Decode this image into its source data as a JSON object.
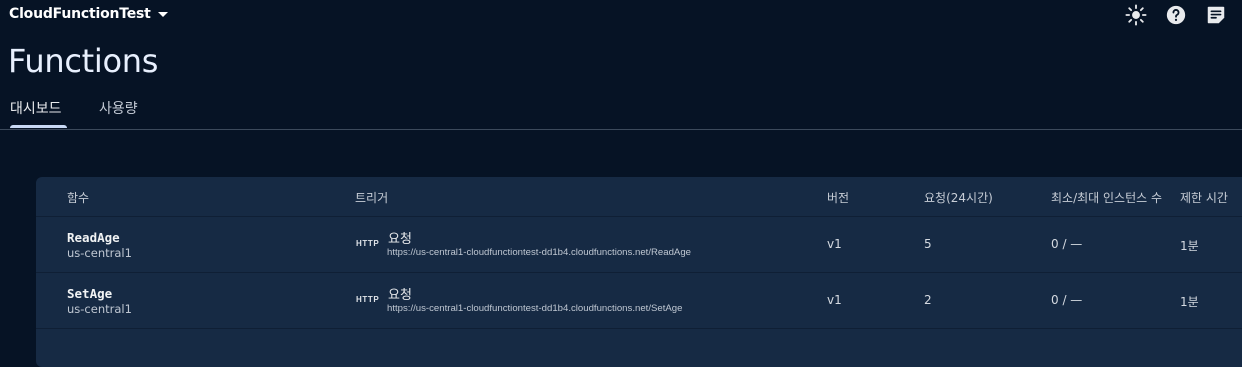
{
  "header": {
    "project": "CloudFunctionTest",
    "icons": [
      "brightness-icon",
      "help-icon",
      "feedback-icon"
    ]
  },
  "page": {
    "title": "Functions"
  },
  "tabs": [
    {
      "label": "대시보드",
      "active": true
    },
    {
      "label": "사용량",
      "active": false
    }
  ],
  "table": {
    "headers": {
      "function": "함수",
      "trigger": "트리거",
      "version": "버전",
      "requests": "요청(24시간)",
      "instances": "최소/최대 인스턴스 수",
      "timeout": "제한 시간"
    },
    "rows": [
      {
        "name": "ReadAge",
        "region": "us-central1",
        "trigger_badge": "HTTP",
        "trigger_type": "요청",
        "trigger_url": "https://us-central1-cloudfunctiontest-dd1b4.cloudfunctions.net/ReadAge",
        "version": "v1",
        "requests": "5",
        "instances": "0 / —",
        "timeout": "1분"
      },
      {
        "name": "SetAge",
        "region": "us-central1",
        "trigger_badge": "HTTP",
        "trigger_type": "요청",
        "trigger_url": "https://us-central1-cloudfunctiontest-dd1b4.cloudfunctions.net/SetAge",
        "version": "v1",
        "requests": "2",
        "instances": "0 / —",
        "timeout": "1분"
      }
    ]
  },
  "colors": {
    "background": "#061325",
    "card": "#162a44",
    "tab_indicator": "#c8d9f5"
  }
}
